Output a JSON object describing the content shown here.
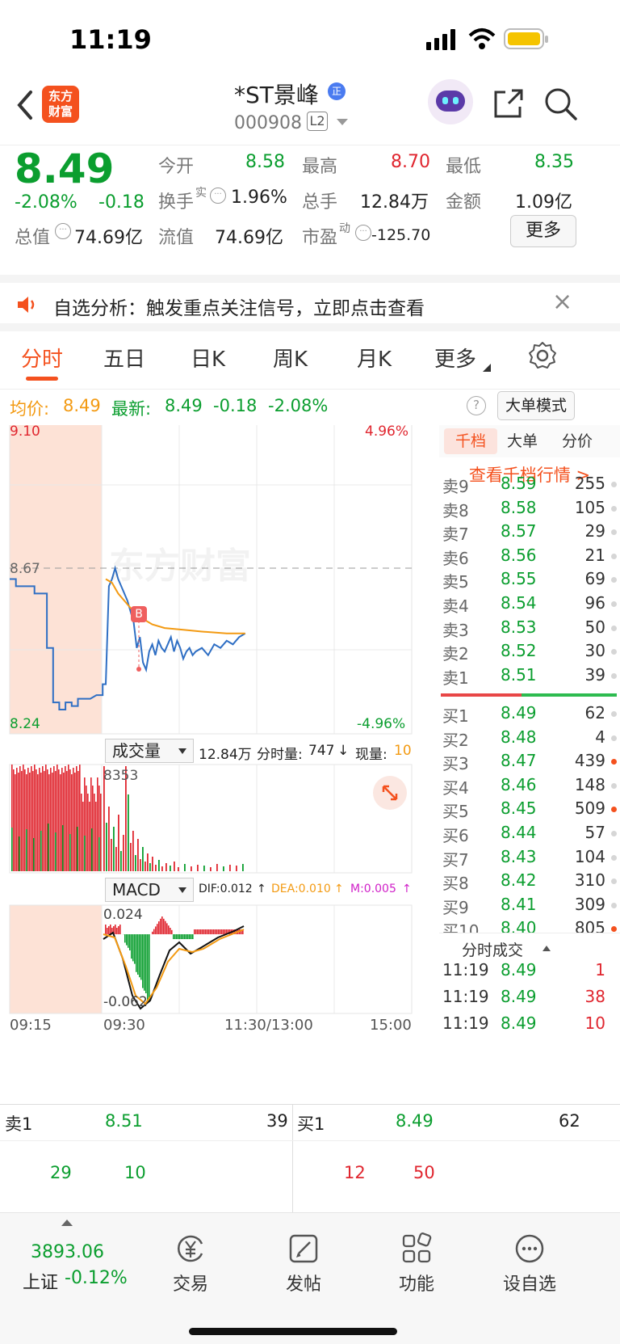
{
  "status_bar": {
    "time": "11:19"
  },
  "header": {
    "back_icon": "chevron-left-icon",
    "logo_text": "东方\n财富",
    "logo_line1": "东方",
    "logo_line2": "财富",
    "stock_name": "*ST景峰",
    "stock_tag": "正",
    "stock_code": "000908",
    "level_badge": "L2",
    "share_icon": "share-icon",
    "search_icon": "search-icon"
  },
  "quote": {
    "price": "8.49",
    "change_pct": "-2.08%",
    "change": "-0.18",
    "fields": [
      {
        "label": "今开",
        "value": "8.58",
        "color": "green"
      },
      {
        "label": "最高",
        "value": "8.70",
        "color": "red"
      },
      {
        "label": "最低",
        "value": "8.35",
        "color": "green"
      },
      {
        "label": "换手",
        "sup": "实",
        "value": "1.96%",
        "color": "black"
      },
      {
        "label": "总手",
        "value": "12.84万",
        "color": "black"
      },
      {
        "label": "金额",
        "value": "1.09亿",
        "color": "black"
      },
      {
        "label": "总值",
        "value": "74.69亿",
        "color": "black"
      },
      {
        "label": "流值",
        "value": "74.69亿",
        "color": "black"
      },
      {
        "label": "市盈",
        "sup": "动",
        "value": "-125.70",
        "color": "black"
      }
    ],
    "more_button": "更多"
  },
  "alert": {
    "text": "自选分析：触发重点关注信号，立即点击查看",
    "close": "×"
  },
  "tabs": [
    {
      "label": "分时",
      "active": true
    },
    {
      "label": "五日"
    },
    {
      "label": "日K"
    },
    {
      "label": "周K"
    },
    {
      "label": "月K"
    },
    {
      "label": "更多"
    }
  ],
  "info_line": {
    "avg_label": "均价:",
    "avg_value": "8.49",
    "last_label": "最新:",
    "last_value": "8.49",
    "last_change": "-0.18",
    "last_pct": "-2.08%",
    "mode_button": "大单模式"
  },
  "chart_data": {
    "type": "line",
    "price_top": "9.10",
    "price_bottom": "8.24",
    "pct_top": "4.96%",
    "pct_bottom": "-4.96%",
    "prev_close": "8.67",
    "ylim": [
      8.24,
      9.1
    ],
    "x_ticks": [
      "09:15",
      "09:30",
      "11:30/13:00",
      "15:00"
    ],
    "watermark": "东方财富",
    "marker": "B",
    "series": [
      {
        "name": "price",
        "color": "#2f6fc4",
        "points": [
          [
            0,
            8.64
          ],
          [
            2,
            8.64
          ],
          [
            2,
            8.62
          ],
          [
            8,
            8.62
          ],
          [
            8,
            8.6
          ],
          [
            12,
            8.6
          ],
          [
            12,
            8.45
          ],
          [
            14,
            8.45
          ],
          [
            14,
            8.3
          ],
          [
            16,
            8.3
          ],
          [
            16,
            8.28
          ],
          [
            18,
            8.28
          ],
          [
            18,
            8.3
          ],
          [
            20,
            8.3
          ],
          [
            20,
            8.29
          ],
          [
            22,
            8.29
          ],
          [
            22,
            8.31
          ],
          [
            24,
            8.31
          ],
          [
            26,
            8.31
          ],
          [
            28,
            8.32
          ],
          [
            30,
            8.32
          ],
          [
            30,
            8.35
          ],
          [
            31,
            8.35
          ],
          [
            32,
            8.62
          ],
          [
            33,
            8.64
          ],
          [
            34,
            8.67
          ],
          [
            35,
            8.64
          ],
          [
            36,
            8.62
          ],
          [
            38,
            8.58
          ],
          [
            40,
            8.52
          ],
          [
            41,
            8.45
          ],
          [
            42,
            8.48
          ],
          [
            43,
            8.41
          ],
          [
            44,
            8.39
          ],
          [
            45,
            8.44
          ],
          [
            46,
            8.46
          ],
          [
            47,
            8.43
          ],
          [
            48,
            8.47
          ],
          [
            49,
            8.45
          ],
          [
            50,
            8.44
          ],
          [
            51,
            8.46
          ],
          [
            52,
            8.48
          ],
          [
            53,
            8.44
          ],
          [
            54,
            8.47
          ],
          [
            55,
            8.45
          ],
          [
            56,
            8.42
          ],
          [
            57,
            8.44
          ],
          [
            58,
            8.45
          ],
          [
            59,
            8.43
          ],
          [
            60,
            8.44
          ],
          [
            62,
            8.45
          ],
          [
            64,
            8.43
          ],
          [
            66,
            8.46
          ],
          [
            68,
            8.45
          ],
          [
            70,
            8.47
          ],
          [
            72,
            8.46
          ],
          [
            74,
            8.48
          ],
          [
            76,
            8.49
          ]
        ]
      },
      {
        "name": "average",
        "color": "#f39a12",
        "points": [
          [
            31,
            8.64
          ],
          [
            33,
            8.63
          ],
          [
            35,
            8.6
          ],
          [
            37,
            8.58
          ],
          [
            39,
            8.56
          ],
          [
            41,
            8.54
          ],
          [
            43,
            8.53
          ],
          [
            46,
            8.515
          ],
          [
            50,
            8.505
          ],
          [
            56,
            8.5
          ],
          [
            62,
            8.495
          ],
          [
            70,
            8.49
          ],
          [
            76,
            8.49
          ]
        ]
      }
    ]
  },
  "volume": {
    "selector": "成交量",
    "total": "12.84万",
    "minute_label": "分时量:",
    "minute_value": "747",
    "now_label": "现量:",
    "now_value": "10",
    "peak": "8353"
  },
  "macd": {
    "selector": "MACD",
    "dif": "DIF:0.012",
    "dea": "DEA:0.010",
    "m": "M:0.005",
    "top": "0.024",
    "bottom": "-0.062"
  },
  "book": {
    "tabs": [
      "千档",
      "大单",
      "分价"
    ],
    "link": "查看千档行情 >",
    "asks": [
      {
        "label": "卖9",
        "price": "8.59",
        "vol": "255"
      },
      {
        "label": "卖8",
        "price": "8.58",
        "vol": "105"
      },
      {
        "label": "卖7",
        "price": "8.57",
        "vol": "29"
      },
      {
        "label": "卖6",
        "price": "8.56",
        "vol": "21"
      },
      {
        "label": "卖5",
        "price": "8.55",
        "vol": "69"
      },
      {
        "label": "卖4",
        "price": "8.54",
        "vol": "96"
      },
      {
        "label": "卖3",
        "price": "8.53",
        "vol": "50"
      },
      {
        "label": "卖2",
        "price": "8.52",
        "vol": "30"
      },
      {
        "label": "卖1",
        "price": "8.51",
        "vol": "39"
      }
    ],
    "bids": [
      {
        "label": "买1",
        "price": "8.49",
        "vol": "62"
      },
      {
        "label": "买2",
        "price": "8.48",
        "vol": "4"
      },
      {
        "label": "买3",
        "price": "8.47",
        "vol": "439"
      },
      {
        "label": "买4",
        "price": "8.46",
        "vol": "148"
      },
      {
        "label": "买5",
        "price": "8.45",
        "vol": "509"
      },
      {
        "label": "买6",
        "price": "8.44",
        "vol": "57"
      },
      {
        "label": "买7",
        "price": "8.43",
        "vol": "104"
      },
      {
        "label": "买8",
        "price": "8.42",
        "vol": "310"
      },
      {
        "label": "买9",
        "price": "8.41",
        "vol": "309"
      },
      {
        "label": "买10",
        "price": "8.40",
        "vol": "805"
      }
    ],
    "trades_header": "分时成交",
    "trades": [
      {
        "time": "11:19",
        "price": "8.49",
        "vol": "1"
      },
      {
        "time": "11:19",
        "price": "8.49",
        "vol": "38"
      },
      {
        "time": "11:19",
        "price": "8.49",
        "vol": "10"
      }
    ]
  },
  "bottom_book": {
    "left": {
      "label": "卖1",
      "price": "8.51",
      "vol": "39",
      "details": [
        "29",
        "10"
      ]
    },
    "right": {
      "label": "买1",
      "price": "8.49",
      "vol": "62",
      "details": [
        "12",
        "50"
      ]
    }
  },
  "tabbar": {
    "index_value": "3893.06",
    "index_name": "上证",
    "index_pct": "-0.12%",
    "items": [
      {
        "label": "交易",
        "icon": "yen-exchange-icon"
      },
      {
        "label": "发帖",
        "icon": "edit-icon"
      },
      {
        "label": "功能",
        "icon": "grid-icon"
      },
      {
        "label": "设自选",
        "icon": "more-circle-icon"
      }
    ]
  }
}
